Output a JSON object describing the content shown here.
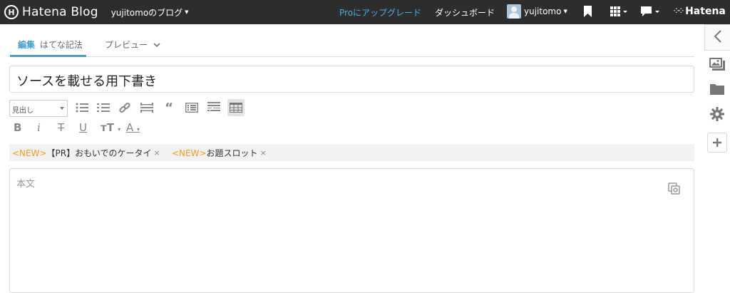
{
  "topbar": {
    "brand_mark": "H",
    "brand_name": "Hatena Blog",
    "blog_menu": "yujitomoのブログ",
    "pro_link": "Proにアップグレード",
    "dashboard_link": "ダッシュボード",
    "username": "yujitomo",
    "hatena_label": "Hatena",
    "pro_link_color": "#45b3e6"
  },
  "tabs": {
    "edit_label": "編集",
    "edit_mode": "はてな記法",
    "preview_label": "プレビュー"
  },
  "editor": {
    "title_value": "ソースを載せる用下書き",
    "heading_select": "見出し",
    "body_placeholder": "本文"
  },
  "notices": [
    {
      "tag": "<NEW>",
      "text": "【PR】おもいでのケータイ",
      "close": "×"
    },
    {
      "tag": "<NEW>",
      "text": "お題スロット",
      "close": "×"
    }
  ],
  "format_toolbar": {
    "bold": "B",
    "italic": "i",
    "strike": "T",
    "underline": "U",
    "font_size": "тT",
    "font_color": "A"
  },
  "colors": {
    "accent": "#45a0cf",
    "new_tag": "#f0a020",
    "topbar_bg": "#2d2d2d"
  },
  "icons": {
    "toolbar_row1": [
      "bullet-list-icon",
      "numbered-list-icon",
      "link-icon",
      "horizontal-rule-icon",
      "quote-icon",
      "table-list-icon",
      "more-break-icon",
      "table-icon"
    ],
    "right_rail": [
      "collapse-icon",
      "image-icon",
      "folder-icon",
      "gear-icon",
      "plus-icon"
    ]
  }
}
